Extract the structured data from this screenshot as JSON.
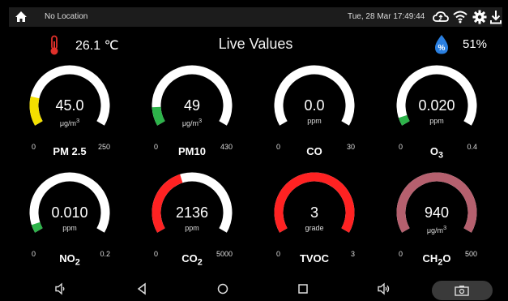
{
  "status_bar": {
    "location": "No Location",
    "datetime": "Tue, 28 Mar  17:49:44",
    "icons": [
      "home-icon",
      "cloud-sync-icon",
      "wifi-icon",
      "settings-gear-icon",
      "download-icon"
    ]
  },
  "header": {
    "title": "Live Values",
    "temperature": "26.1 ℃",
    "humidity": "51%",
    "icons": [
      "thermometer-icon",
      "humidity-drop-icon"
    ]
  },
  "gauges": [
    {
      "name_html": "PM 2.5",
      "value": "45.0",
      "unit_html": "μg/m<sup>3</sup>",
      "min": "0",
      "max": "250",
      "fraction": 0.18,
      "color": "#f4e000"
    },
    {
      "name_html": "PM10",
      "value": "49",
      "unit_html": "μg/m<sup>3</sup>",
      "min": "0",
      "max": "430",
      "fraction": 0.114,
      "color": "#2db34a"
    },
    {
      "name_html": "CO",
      "value": "0.0",
      "unit_html": "ppm",
      "min": "0",
      "max": "30",
      "fraction": 0.0,
      "color": "#2db34a"
    },
    {
      "name_html": "O<sub>3</sub>",
      "value": "0.020",
      "unit_html": "ppm",
      "min": "0",
      "max": "0.4",
      "fraction": 0.05,
      "color": "#2db34a"
    },
    {
      "name_html": "NO<sub>2</sub>",
      "value": "0.010",
      "unit_html": "ppm",
      "min": "0",
      "max": "0.2",
      "fraction": 0.05,
      "color": "#2db34a"
    },
    {
      "name_html": "CO<sub>2</sub>",
      "value": "2136",
      "unit_html": "ppm",
      "min": "0",
      "max": "5000",
      "fraction": 0.427,
      "color": "#ff2222"
    },
    {
      "name_html": "TVOC",
      "value": "3",
      "unit_html": "grade",
      "min": "0",
      "max": "3",
      "fraction": 1.0,
      "color": "#ff2222"
    },
    {
      "name_html": "CH<sub>2</sub>O",
      "value": "940",
      "unit_html": "μg/m<sup>3</sup>",
      "min": "0",
      "max": "500",
      "fraction": 1.0,
      "color": "#b5606e"
    }
  ],
  "nav_bar": {
    "icons": [
      "volume-down-icon",
      "back-icon",
      "home-circle-icon",
      "recents-icon",
      "volume-up-icon",
      "screenshot-camera-icon"
    ]
  }
}
